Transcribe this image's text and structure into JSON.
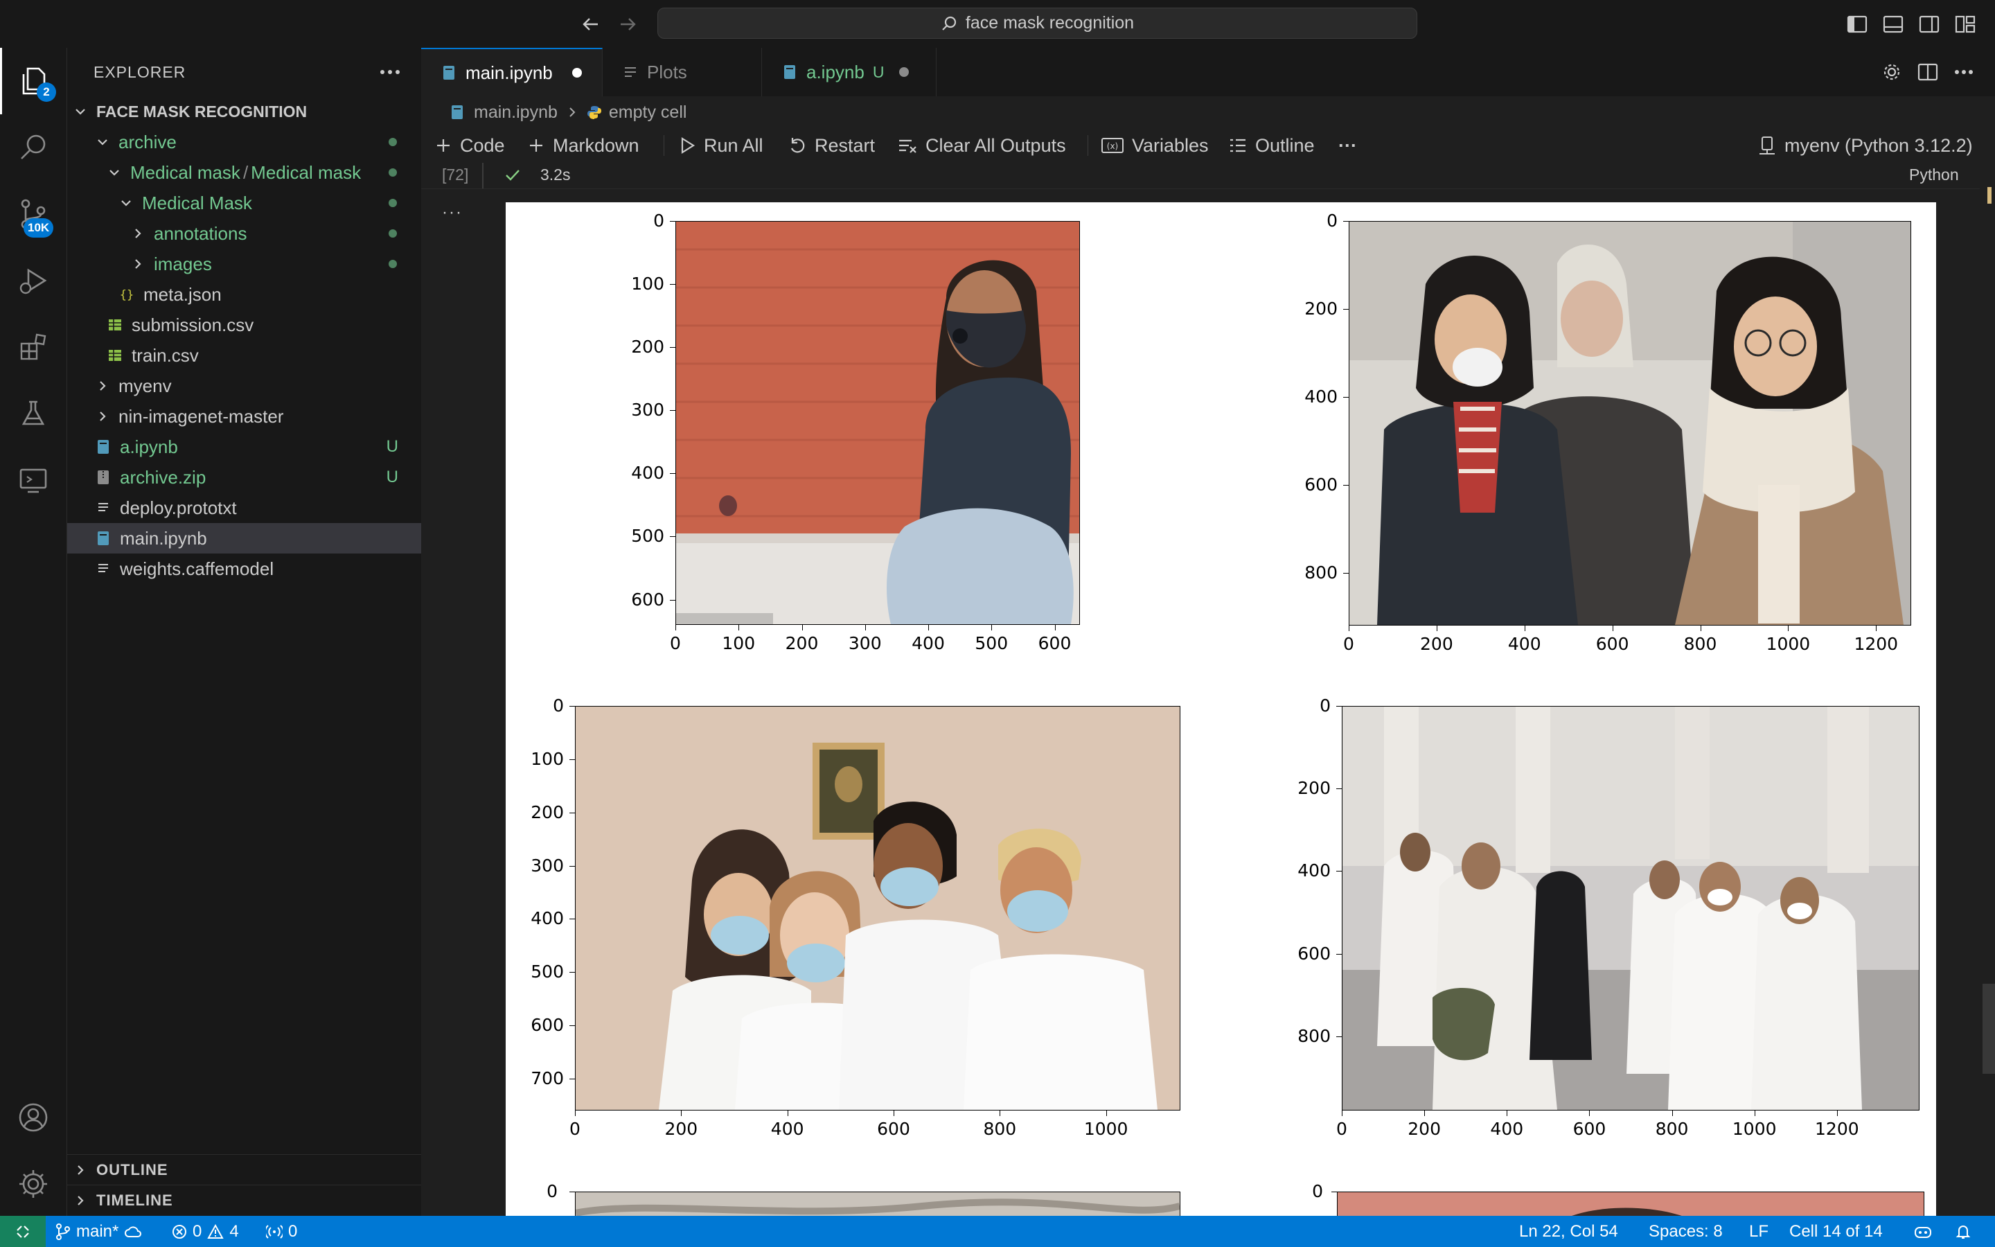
{
  "titlebar": {
    "search_text": "face mask recognition"
  },
  "activity": {
    "explorer_badge": "2",
    "scm_badge": "10K"
  },
  "sidebar": {
    "title": "EXPLORER",
    "root": "FACE MASK RECOGNITION",
    "items": [
      {
        "label": "archive",
        "kind": "folder",
        "open": true,
        "depth": 0,
        "status": "dot",
        "color": "green"
      },
      {
        "label": "Medical mask",
        "label2": "Medical mask",
        "kind": "folder",
        "open": true,
        "depth": 1,
        "status": "dot",
        "color": "green"
      },
      {
        "label": "Medical Mask",
        "kind": "folder",
        "open": true,
        "depth": 2,
        "status": "dot",
        "color": "green"
      },
      {
        "label": "annotations",
        "kind": "folder",
        "open": false,
        "depth": 3,
        "status": "dot",
        "color": "green"
      },
      {
        "label": "images",
        "kind": "folder",
        "open": false,
        "depth": 3,
        "status": "dot",
        "color": "green"
      },
      {
        "label": "meta.json",
        "kind": "json",
        "depth": 2,
        "status": "",
        "color": "white"
      },
      {
        "label": "submission.csv",
        "kind": "csv",
        "depth": 1,
        "status": "",
        "color": "white"
      },
      {
        "label": "train.csv",
        "kind": "csv",
        "depth": 1,
        "status": "",
        "color": "white"
      },
      {
        "label": "myenv",
        "kind": "folder",
        "open": false,
        "depth": 0,
        "status": "",
        "color": "white"
      },
      {
        "label": "nin-imagenet-master",
        "kind": "folder",
        "open": false,
        "depth": 0,
        "status": "",
        "color": "white"
      },
      {
        "label": "a.ipynb",
        "kind": "notebook",
        "depth": 0,
        "status": "U",
        "color": "green"
      },
      {
        "label": "archive.zip",
        "kind": "zip",
        "depth": 0,
        "status": "U",
        "color": "green"
      },
      {
        "label": "deploy.prototxt",
        "kind": "text",
        "depth": 0,
        "status": "",
        "color": "white"
      },
      {
        "label": "main.ipynb",
        "kind": "notebook",
        "depth": 0,
        "status": "",
        "color": "white",
        "selected": true
      },
      {
        "label": "weights.caffemodel",
        "kind": "text",
        "depth": 0,
        "status": "",
        "color": "white"
      }
    ],
    "outline": "OUTLINE",
    "timeline": "TIMELINE"
  },
  "tabs": [
    {
      "label": "main.ipynb",
      "modified": true
    },
    {
      "label": "Plots"
    },
    {
      "label": "a.ipynb",
      "status": "U",
      "modified": true
    }
  ],
  "breadcrumbs": {
    "file": "main.ipynb",
    "cell": "empty cell"
  },
  "toolbar": {
    "code": "Code",
    "markdown": "Markdown",
    "run_all": "Run All",
    "restart": "Restart",
    "clear": "Clear All Outputs",
    "variables": "Variables",
    "outline": "Outline",
    "more": "···",
    "kernel": "myenv (Python 3.12.2)"
  },
  "cell": {
    "exec_count": "[72]",
    "duration": "3.2s",
    "language": "Python",
    "more": "···"
  },
  "plots": [
    {
      "xticks": [
        "0",
        "100",
        "200",
        "300",
        "400",
        "500",
        "600"
      ],
      "yticks": [
        "0",
        "100",
        "200",
        "300",
        "400",
        "500",
        "600"
      ],
      "xmax": 640,
      "ymax": 640,
      "image": "woman-black-mask-brick-wall"
    },
    {
      "xticks": [
        "0",
        "200",
        "400",
        "600",
        "800",
        "1000",
        "1200"
      ],
      "yticks": [
        "0",
        "200",
        "400",
        "600",
        "800"
      ],
      "xmax": 1280,
      "ymax": 920,
      "image": "two-women-white-masks-winter"
    },
    {
      "xticks": [
        "0",
        "200",
        "400",
        "600",
        "800",
        "1000"
      ],
      "yticks": [
        "0",
        "100",
        "200",
        "300",
        "400",
        "500",
        "600",
        "700"
      ],
      "xmax": 1140,
      "ymax": 760,
      "image": "four-people-blue-masks-mona-lisa"
    },
    {
      "xticks": [
        "0",
        "200",
        "400",
        "600",
        "800",
        "1000",
        "1200"
      ],
      "yticks": [
        "0",
        "200",
        "400",
        "600",
        "800"
      ],
      "xmax": 1400,
      "ymax": 980,
      "image": "pilgrims-white-robes-masks"
    }
  ],
  "statusbar": {
    "branch": "main*",
    "errors": "0",
    "warnings": "4",
    "ports": "0",
    "position": "Ln 22, Col 54",
    "spaces": "Spaces: 8",
    "eol": "LF",
    "cell": "Cell 14 of 14"
  }
}
